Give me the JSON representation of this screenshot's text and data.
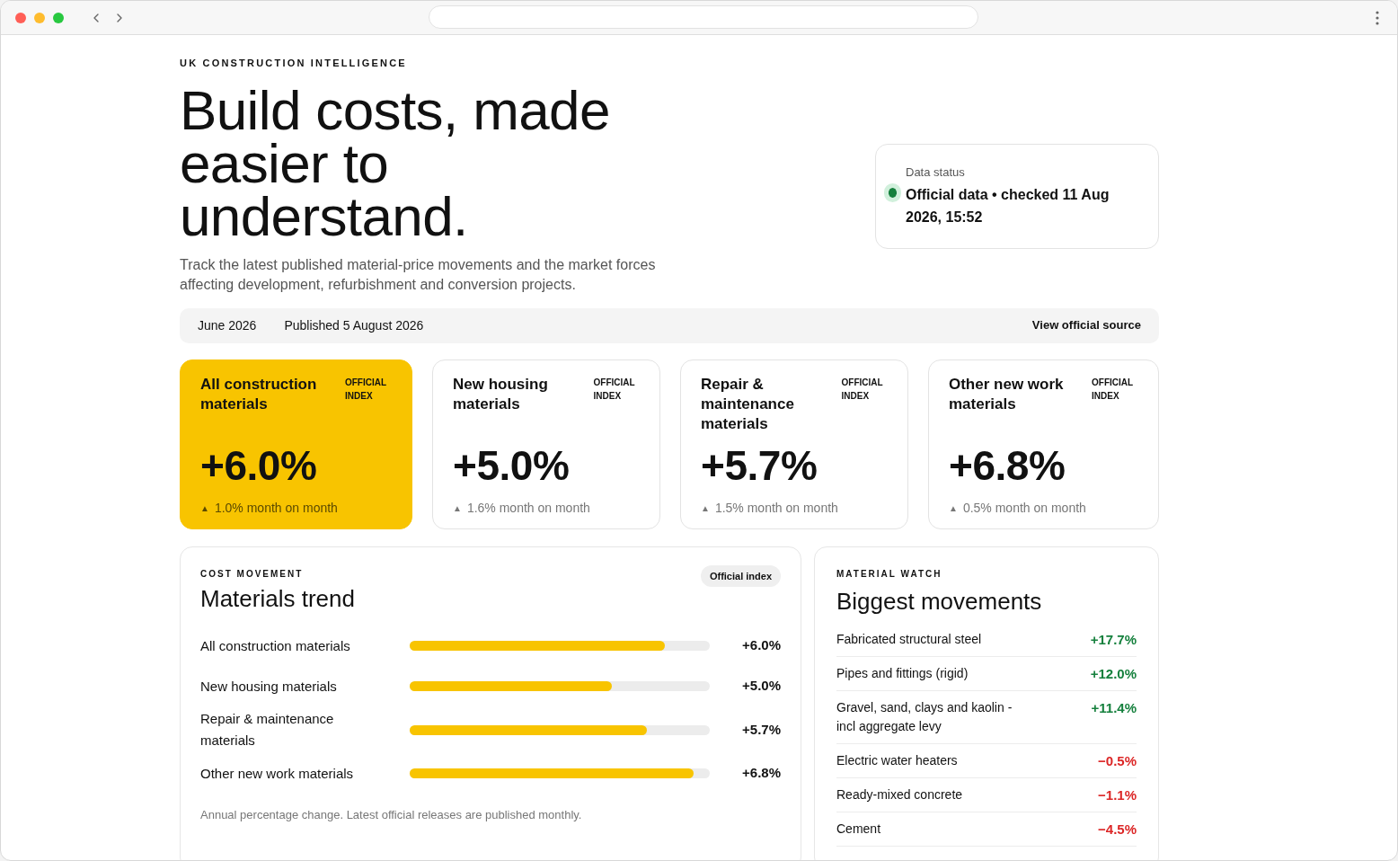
{
  "eyebrow": "UK CONSTRUCTION INTELLIGENCE",
  "headline": "Build costs, made easier to understand.",
  "intro": "Track the latest published material-price movements and the market forces affecting development, refurbishment and conversion projects.",
  "status": {
    "label": "Data status",
    "text": "Official data • checked 11 Aug 2026, 15:52",
    "color": "#15803d"
  },
  "release_bar": {
    "period": "June 2026",
    "published": "Published 5 August 2026",
    "link": "View official source"
  },
  "index_cards": [
    {
      "title": "All construction materials",
      "badge": "OFFICIAL INDEX",
      "value": "+6.0%",
      "arrow": "▲",
      "change": "1.0% month on month",
      "selected": true
    },
    {
      "title": "New housing materials",
      "badge": "OFFICIAL INDEX",
      "value": "+5.0%",
      "arrow": "▲",
      "change": "1.6% month on month",
      "selected": false
    },
    {
      "title": "Repair & maintenance materials",
      "badge": "OFFICIAL INDEX",
      "value": "+5.7%",
      "arrow": "▲",
      "change": "1.5% month on month",
      "selected": false
    },
    {
      "title": "Other new work materials",
      "badge": "OFFICIAL INDEX",
      "value": "+6.8%",
      "arrow": "▲",
      "change": "0.5% month on month",
      "selected": false
    }
  ],
  "trend": {
    "eyebrow": "COST MOVEMENT",
    "title": "Materials trend",
    "tag": "Official index",
    "note": "Annual percentage change. Latest official releases are published monthly.",
    "rows": [
      {
        "label": "All construction materials",
        "level": 0.85,
        "value": "+6.0%"
      },
      {
        "label": "New housing materials",
        "level": 0.675,
        "value": "+5.0%"
      },
      {
        "label": "Repair & maintenance materials",
        "level": 0.79,
        "value": "+5.7%"
      },
      {
        "label": "Other new work materials",
        "level": 0.945,
        "value": "+6.8%"
      }
    ]
  },
  "movements": {
    "eyebrow": "MATERIAL WATCH",
    "title": "Biggest movements",
    "rows": [
      {
        "label": "Fabricated structural steel",
        "value": "+17.7%",
        "kind": "rise"
      },
      {
        "label": "Pipes and fittings (rigid)",
        "value": "+12.0%",
        "kind": "rise"
      },
      {
        "label": "Gravel, sand, clays and kaolin - incl aggregate levy",
        "value": "+11.4%",
        "kind": "rise"
      },
      {
        "label": "Electric water heaters",
        "value": "−0.5%",
        "kind": "fall"
      },
      {
        "label": "Ready-mixed concrete",
        "value": "−1.1%",
        "kind": "fall"
      },
      {
        "label": "Cement",
        "value": "−4.5%",
        "kind": "fall"
      }
    ]
  }
}
